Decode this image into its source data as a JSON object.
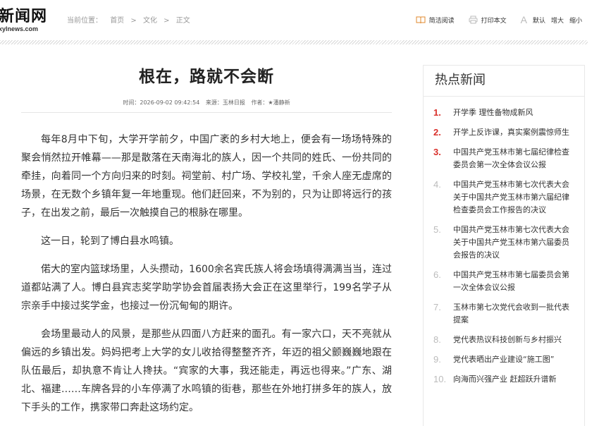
{
  "logo": {
    "main": "新闻网",
    "sub": "xylnews.com"
  },
  "breadcrumb": {
    "label": "当前位置：",
    "home": "首页",
    "section": "文化",
    "current": "正文",
    "sep": ">"
  },
  "tools": {
    "simple_read": "简洁阅读",
    "print": "打印本文",
    "font_default": "默认",
    "font_larger": "增大",
    "font_smaller": "缩小"
  },
  "article": {
    "title": "根在，路就不会断",
    "meta": {
      "time": "时间：2026-09-02 09:42:54",
      "source": "来源：玉林日报",
      "author": "作者：★潘静新"
    },
    "paragraphs": [
      "每年8月中下旬，大学开学前夕，中国广袤的乡村大地上，便会有一场场特殊的聚会悄然拉开帷幕——那是散落在天南海北的族人，因一个共同的姓氏、一份共同的牵挂，向着同一个方向归来的时刻。祠堂前、村广场、学校礼堂，千余人座无虚席的场景，在无数个乡镇年复一年地重现。他们赶回来，不为别的，只为让即将远行的孩子，在出发之前，最后一次触摸自己的根脉在哪里。",
      "这一日，轮到了博白县水鸣镇。",
      "偌大的室内篮球场里，人头攒动，1600余名宾氏族人将会场填得满满当当，连过道都站满了人。博白县宾志奖学助学协会首届表扬大会正在这里举行，199名学子从宗亲手中接过奖学金，也接过一份沉甸甸的期许。",
      "会场里最动人的风景，是那些从四面八方赶来的面孔。有一家六口，天不亮就从偏远的乡镇出发。妈妈把考上大学的女儿收拾得整整齐齐，年迈的祖父颤巍巍地跟在队伍最后，却执意不肯让人搀扶。“宾家的大事，我还能走，再远也得来。”广东、湖北、福建……车牌各异的小车停满了水鸣镇的街巷，那些在外地打拼多年的族人，放下手头的工作，携家带口奔赴这场约定。"
    ]
  },
  "sidebar": {
    "title": "热点新闻",
    "items": [
      {
        "rank": "1.",
        "text": "开学季 理性备物成新风"
      },
      {
        "rank": "2.",
        "text": "开学上反诈课，真实案例震惊师生"
      },
      {
        "rank": "3.",
        "text": "中国共产党玉林市第七届纪律检查委员会第一次全体会议公报"
      },
      {
        "rank": "4.",
        "text": "中国共产党玉林市第七次代表大会关于中国共产党玉林市第六届纪律检查委员会工作报告的决议"
      },
      {
        "rank": "5.",
        "text": "中国共产党玉林市第七次代表大会关于中国共产党玉林市第六届委员会报告的决议"
      },
      {
        "rank": "6.",
        "text": "中国共产党玉林市第七届委员会第一次全体会议公报"
      },
      {
        "rank": "7.",
        "text": "玉林市第七次党代会收到一批代表提案"
      },
      {
        "rank": "8.",
        "text": "党代表热议科技创新与乡村振兴"
      },
      {
        "rank": "9.",
        "text": "党代表晒出产业建设“施工图”"
      },
      {
        "rank": "10.",
        "text": "向海而兴强产业 赶超跃升谱新"
      }
    ]
  },
  "colors": {
    "accent_red": "#d9302b",
    "text": "#333333",
    "muted": "#999999"
  }
}
